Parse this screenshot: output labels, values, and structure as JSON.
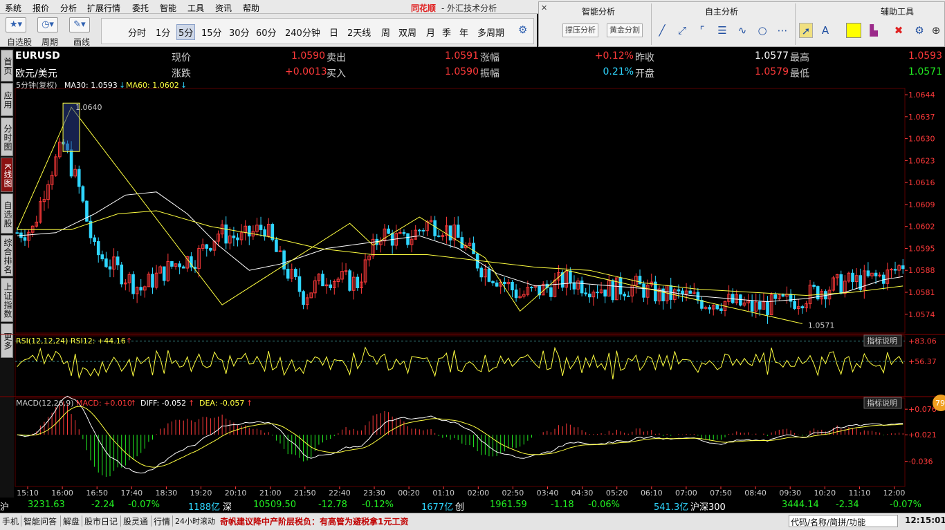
{
  "menu": [
    "系统",
    "报价",
    "分析",
    "扩展行情",
    "委托",
    "智能",
    "工具",
    "资讯",
    "帮助"
  ],
  "title": {
    "brand": "同花顺",
    "text": "- 外汇技术分析"
  },
  "toolbar": {
    "watch_label": "自选股",
    "cycle_label": "周期",
    "draw_label": "画线"
  },
  "periods": [
    "分时",
    "1分",
    "5分",
    "15分",
    "30分",
    "60分",
    "240分钟",
    "日",
    "2天线",
    "周",
    "双周",
    "月",
    "季",
    "年",
    "多周期"
  ],
  "active_period": "5分",
  "panels": {
    "smart": {
      "title": "智能分析",
      "btn1": "撑压分析",
      "btn2": "黄金分割"
    },
    "self": {
      "title": "自主分析"
    },
    "aux": {
      "title": "辅助工具"
    }
  },
  "sidetabs": [
    "首页",
    "应用",
    "分时图",
    "K线图",
    "自选股",
    "综合排名",
    "上证指数",
    "更多"
  ],
  "quote": {
    "symbol": "EURUSD",
    "name": "欧元/美元",
    "price_label": "现价",
    "price": "1.0590",
    "change_label": "涨跌",
    "change": "+0.0013",
    "sell_label": "卖出",
    "sell": "1.0591",
    "buy_label": "买入",
    "buy": "1.0590",
    "pct_label": "涨幅",
    "pct": "+0.12%",
    "amp_label": "振幅",
    "amp": "0.21%",
    "prev_label": "昨收",
    "prev": "1.0577",
    "open_label": "开盘",
    "open": "1.0579",
    "high_label": "最高",
    "high": "1.0593",
    "low_label": "最低",
    "low": "1.0571"
  },
  "chart_header": {
    "period": "5分钟(复权)",
    "ma30": "MA30: 1.0593",
    "ma60": "MA60: 1.0602",
    "rsi": "RSI(12,12,24)  RSI12: +44.16",
    "macd_name": "MACD(12,26,9)",
    "macd": "MACD: +0.010",
    "diff": "DIFF: -0.052",
    "dea": "DEA: -0.057",
    "explain": "指标说明"
  },
  "chart_data": {
    "type": "line",
    "y_ticks": [
      "1.0644",
      "1.0637",
      "1.0630",
      "1.0623",
      "1.0616",
      "1.0609",
      "1.0602",
      "1.0595",
      "1.0588",
      "1.0581",
      "1.0574"
    ],
    "rsi_ticks": [
      "+83.06",
      "+56.37"
    ],
    "macd_ticks": [
      "+0.076",
      "+0.021",
      "-0.036"
    ],
    "x_ticks": [
      "15:10",
      "16:00",
      "16:50",
      "17:40",
      "18:30",
      "19:20",
      "20:10",
      "21:00",
      "21:50",
      "22:40",
      "23:30",
      "00:20",
      "01:10",
      "02:00",
      "02:50",
      "03:40",
      "04:30",
      "05:20",
      "06:10",
      "07:00",
      "07:50",
      "08:40",
      "09:30",
      "10:20",
      "11:10",
      "12:00"
    ],
    "high_marker": "1.0640",
    "low_marker": "1.0571",
    "badge": "79",
    "close_pivots": [
      [
        0,
        1.06
      ],
      [
        4,
        1.0601
      ],
      [
        8,
        1.0618
      ],
      [
        12,
        1.0628
      ],
      [
        16,
        1.0614
      ],
      [
        20,
        1.0594
      ],
      [
        26,
        1.0588
      ],
      [
        32,
        1.0582
      ],
      [
        36,
        1.0586
      ],
      [
        42,
        1.0591
      ],
      [
        46,
        1.0592
      ],
      [
        52,
        1.06
      ],
      [
        58,
        1.0598
      ],
      [
        64,
        1.0602
      ],
      [
        68,
        1.0591
      ],
      [
        74,
        1.058
      ],
      [
        80,
        1.0586
      ],
      [
        88,
        1.0584
      ],
      [
        94,
        1.06
      ],
      [
        100,
        1.0597
      ],
      [
        106,
        1.0603
      ],
      [
        110,
        1.0602
      ],
      [
        114,
        1.0598
      ],
      [
        120,
        1.0589
      ],
      [
        126,
        1.0584
      ],
      [
        130,
        1.058
      ],
      [
        136,
        1.0582
      ],
      [
        142,
        1.0585
      ],
      [
        148,
        1.0583
      ],
      [
        154,
        1.0582
      ],
      [
        160,
        1.0583
      ],
      [
        166,
        1.058
      ],
      [
        172,
        1.058
      ],
      [
        178,
        1.0578
      ],
      [
        184,
        1.0578
      ],
      [
        190,
        1.0576
      ],
      [
        196,
        1.0577
      ],
      [
        202,
        1.0579
      ],
      [
        208,
        1.0582
      ],
      [
        214,
        1.0584
      ],
      [
        220,
        1.0585
      ],
      [
        226,
        1.0587
      ],
      [
        229,
        1.059
      ]
    ],
    "ma30": [
      [
        0,
        1.0599
      ],
      [
        10,
        1.06
      ],
      [
        20,
        1.0606
      ],
      [
        28,
        1.0612
      ],
      [
        36,
        1.0613
      ],
      [
        44,
        1.0606
      ],
      [
        52,
        1.0596
      ],
      [
        60,
        1.0588
      ],
      [
        68,
        1.059
      ],
      [
        80,
        1.0595
      ],
      [
        92,
        1.0597
      ],
      [
        104,
        1.0599
      ],
      [
        114,
        1.0595
      ],
      [
        124,
        1.0587
      ],
      [
        134,
        1.0583
      ],
      [
        144,
        1.0584
      ],
      [
        154,
        1.0583
      ],
      [
        164,
        1.0582
      ],
      [
        174,
        1.058
      ],
      [
        184,
        1.0579
      ],
      [
        194,
        1.0578
      ],
      [
        204,
        1.0579
      ],
      [
        214,
        1.0581
      ],
      [
        224,
        1.0585
      ],
      [
        229,
        1.0586
      ]
    ],
    "ma60": [
      [
        0,
        1.0601
      ],
      [
        14,
        1.0601
      ],
      [
        26,
        1.0606
      ],
      [
        36,
        1.0607
      ],
      [
        50,
        1.0602
      ],
      [
        64,
        1.0599
      ],
      [
        78,
        1.0595
      ],
      [
        92,
        1.0593
      ],
      [
        106,
        1.0593
      ],
      [
        120,
        1.0591
      ],
      [
        134,
        1.0589
      ],
      [
        148,
        1.0588
      ],
      [
        162,
        1.0584
      ],
      [
        176,
        1.0582
      ],
      [
        190,
        1.0581
      ],
      [
        204,
        1.058
      ],
      [
        216,
        1.0581
      ],
      [
        229,
        1.0583
      ]
    ],
    "zigzag": [
      [
        0,
        1.0601
      ],
      [
        14,
        1.064
      ],
      [
        53,
        1.0577
      ],
      [
        86,
        1.0603
      ],
      [
        92,
        1.0596
      ],
      [
        104,
        1.0605
      ],
      [
        121,
        1.0592
      ],
      [
        130,
        1.0575
      ],
      [
        142,
        1.0588
      ],
      [
        203,
        1.0571
      ]
    ]
  },
  "ticker": {
    "sh_label": "沪",
    "sh_val": "3231.63",
    "sh_chg": "-2.24",
    "sh_pct": "-0.07%",
    "sh_amt": "1188亿",
    "sz_label": "深",
    "sz_val": "10509.50",
    "sz_chg": "-12.78",
    "sz_pct": "-0.12%",
    "sz_amt": "1677亿",
    "cy_label": "创",
    "cy_val": "1961.59",
    "cy_chg": "-1.18",
    "cy_pct": "-0.06%",
    "cy_amt": "541.3亿",
    "hs_label": "沪深300",
    "hs_val": "3444.14",
    "hs_chg": "-2.34",
    "hs_pct": "-0.07%"
  },
  "status": {
    "items": [
      "手机",
      "智能问答",
      "解盘",
      "股市日记",
      "股灵通",
      "行情",
      "24小时滚动"
    ],
    "news": "奇帆建议降中产阶层税负：有高管为避税拿1元工资",
    "search": "代码/名称/简拼/功能",
    "time": "12:15:01"
  },
  "colors": {
    "up": "#ff3a3a",
    "down": "#22ee22",
    "cyan": "#2fd6ff",
    "yellow": "#ffff40",
    "grid": "#5a0000"
  }
}
